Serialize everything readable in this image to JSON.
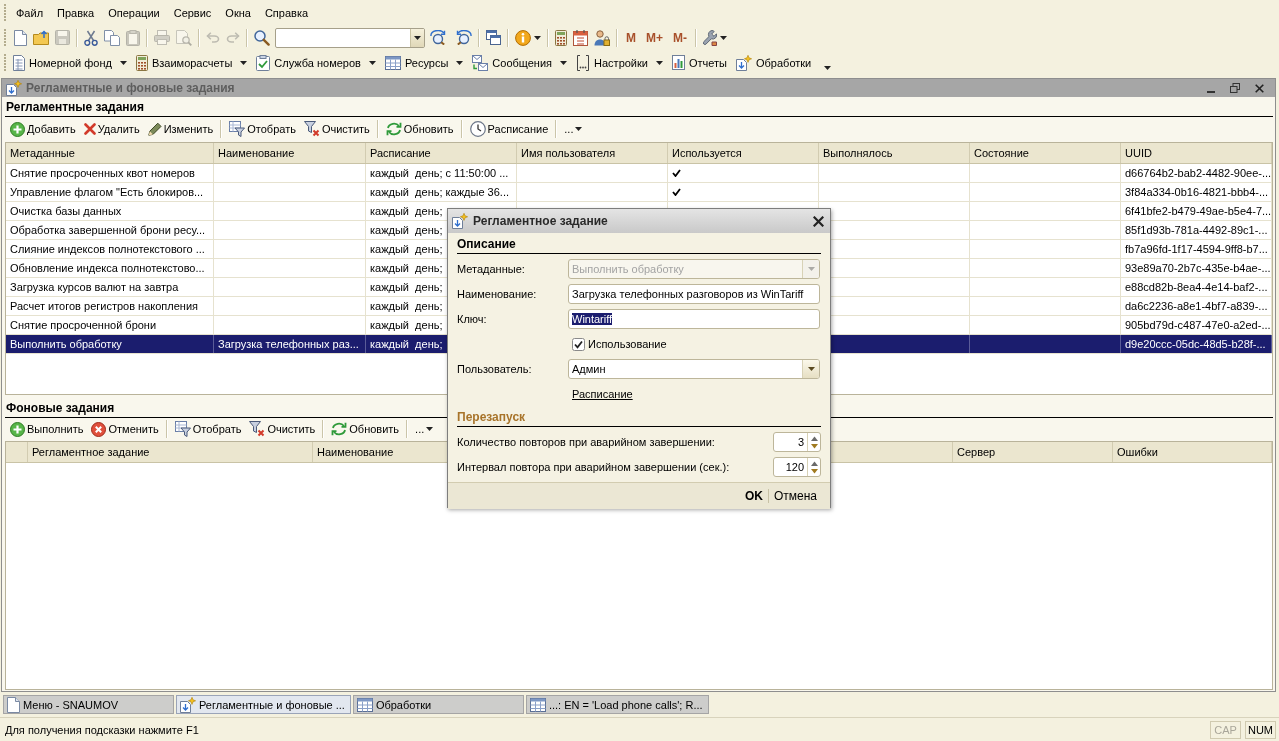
{
  "menu_bar": {
    "items": [
      {
        "label": "Файл"
      },
      {
        "label": "Правка"
      },
      {
        "label": "Операции"
      },
      {
        "label": "Сервис"
      },
      {
        "label": "Окна"
      },
      {
        "label": "Справка"
      }
    ]
  },
  "standard_toolbar": {
    "items": [
      {
        "kind": "button",
        "disabled": false,
        "dropdown": false
      },
      {
        "kind": "button",
        "disabled": false,
        "dropdown": false
      },
      {
        "kind": "button",
        "disabled": true,
        "dropdown": false
      },
      {
        "kind": "separator"
      },
      {
        "kind": "button",
        "disabled": false,
        "dropdown": false
      },
      {
        "kind": "button",
        "disabled": false,
        "dropdown": false
      },
      {
        "kind": "button",
        "disabled": true,
        "dropdown": false
      },
      {
        "kind": "separator"
      },
      {
        "kind": "button",
        "disabled": true,
        "dropdown": false
      },
      {
        "kind": "button",
        "disabled": true,
        "dropdown": false
      },
      {
        "kind": "separator"
      },
      {
        "kind": "button",
        "disabled": true,
        "dropdown": false
      },
      {
        "kind": "button",
        "disabled": true,
        "dropdown": false
      },
      {
        "kind": "separator"
      },
      {
        "kind": "button",
        "disabled": false,
        "dropdown": false
      },
      {
        "kind": "search"
      },
      {
        "kind": "button",
        "disabled": false,
        "dropdown": false
      },
      {
        "kind": "button",
        "disabled": false,
        "dropdown": false
      },
      {
        "kind": "separator"
      },
      {
        "kind": "button",
        "disabled": false,
        "dropdown": false
      },
      {
        "kind": "separator"
      },
      {
        "kind": "button",
        "disabled": false,
        "dropdown": true
      },
      {
        "kind": "separator"
      },
      {
        "kind": "button",
        "disabled": false,
        "dropdown": false
      },
      {
        "kind": "button",
        "disabled": false,
        "dropdown": false
      },
      {
        "kind": "button",
        "disabled": false,
        "dropdown": false
      },
      {
        "kind": "separator"
      },
      {
        "kind": "text",
        "label": "M"
      },
      {
        "kind": "text",
        "label": "M+"
      },
      {
        "kind": "text",
        "label": "M-"
      },
      {
        "kind": "separator"
      },
      {
        "kind": "button",
        "disabled": false,
        "dropdown": true
      }
    ]
  },
  "sections_toolbar": {
    "items": [
      {
        "label": "Номерной фонд",
        "dropdown": true
      },
      {
        "label": "Взаиморасчеты",
        "dropdown": true
      },
      {
        "label": "Служба номеров",
        "dropdown": true
      },
      {
        "label": "Ресурсы",
        "dropdown": true
      },
      {
        "label": "Сообщения",
        "dropdown": true
      },
      {
        "label": "Настройки",
        "dropdown": true
      },
      {
        "label": "Отчеты",
        "dropdown": false
      },
      {
        "label": "Обработки",
        "dropdown": false
      }
    ],
    "overflow": true
  },
  "window": {
    "title": "Регламентные и фоновые задания"
  },
  "scheduled_jobs": {
    "title": "Регламентные задания",
    "toolbar": [
      {
        "kind": "button",
        "label": "Добавить"
      },
      {
        "kind": "button",
        "label": "Удалить"
      },
      {
        "kind": "button",
        "label": "Изменить"
      },
      {
        "kind": "separator"
      },
      {
        "kind": "button",
        "label": "Отобрать"
      },
      {
        "kind": "button",
        "label": "Очистить"
      },
      {
        "kind": "separator"
      },
      {
        "kind": "button",
        "label": "Обновить"
      },
      {
        "kind": "separator"
      },
      {
        "kind": "button",
        "label": "Расписание"
      },
      {
        "kind": "separator"
      },
      {
        "kind": "menu",
        "label": "..."
      }
    ],
    "columns": [
      {
        "label": "Метаданные"
      },
      {
        "label": "Наименование"
      },
      {
        "label": "Расписание"
      },
      {
        "label": "Имя пользователя"
      },
      {
        "label": "Используется"
      },
      {
        "label": "Выполнялось"
      },
      {
        "label": "Состояние"
      },
      {
        "label": "UUID"
      }
    ],
    "rows": [
      {
        "metadata": "Снятие просроченных квот номеров",
        "schedule": "каждый  день; с 11:50:00 ...",
        "used": true,
        "uuid": "d66764b2-bab2-4482-90ee-...",
        "selected": false
      },
      {
        "metadata": "Управление флагом \"Есть блокиров...",
        "schedule": "каждый  день; каждые 36...",
        "used": true,
        "uuid": "3f84a334-0b16-4821-bbb4-...",
        "selected": false
      },
      {
        "metadata": "Очистка базы данных",
        "schedule": "каждый  день;",
        "uuid": "6f41bfe2-b479-49ae-b5e4-7...",
        "selected": false
      },
      {
        "metadata": "Обработка завершенной брони ресу...",
        "schedule": "каждый  день;",
        "uuid": "85f1d93b-781a-4492-89c1-...",
        "selected": false
      },
      {
        "metadata": "Слияние индексов полнотекстового ...",
        "schedule": "каждый  день;",
        "uuid": "fb7a96fd-1f17-4594-9ff8-b7...",
        "selected": false
      },
      {
        "metadata": "Обновление индекса полнотекстово...",
        "schedule": "каждый  день;",
        "uuid": "93e89a70-2b7c-435e-b4ae-...",
        "selected": false
      },
      {
        "metadata": "Загрузка курсов валют на завтра",
        "schedule": "каждый  день;",
        "uuid": "e88cd82b-8ea4-4e14-baf2-...",
        "selected": false
      },
      {
        "metadata": "Расчет итогов регистров накопления",
        "schedule": "каждый  день;",
        "uuid": "da6c2236-a8e1-4bf7-a839-...",
        "selected": false
      },
      {
        "metadata": "Снятие просроченной брони",
        "schedule": "каждый  день;",
        "uuid": "905bd79d-c487-47e0-a2ed-...",
        "selected": false
      },
      {
        "metadata": "Выполнить обработку",
        "name": "Загрузка телефонных раз...",
        "schedule": "каждый  день;",
        "uuid": "d9e20ccc-05dc-48d5-b28f-...",
        "selected": true
      }
    ]
  },
  "background_jobs": {
    "title": "Фоновые задания",
    "toolbar": [
      {
        "kind": "button",
        "label": "Выполнить"
      },
      {
        "kind": "button",
        "label": "Отменить"
      },
      {
        "kind": "separator"
      },
      {
        "kind": "button",
        "label": "Отобрать"
      },
      {
        "kind": "button",
        "label": "Очистить"
      },
      {
        "kind": "separator"
      },
      {
        "kind": "button",
        "label": "Обновить"
      },
      {
        "kind": "separator"
      },
      {
        "kind": "menu",
        "label": "..."
      }
    ],
    "columns": [
      {
        "label": "Регламентное задание"
      },
      {
        "label": "Наименование"
      },
      {
        "label": "Сервер"
      },
      {
        "label": "Ошибки"
      }
    ]
  },
  "dialog": {
    "title": "Регламентное задание",
    "description_section": "Описание",
    "fields": [
      {
        "kind": "combo",
        "label": "Метаданные:",
        "value": "Выполнить обработку",
        "disabled": true
      },
      {
        "kind": "text",
        "label": "Наименование:",
        "value": "Загрузка телефонных разговоров из WinTariff",
        "disabled": false,
        "text_selected": false
      },
      {
        "kind": "text",
        "label": "Ключ:",
        "value": "Wintariff",
        "disabled": false,
        "text_selected": true
      },
      {
        "kind": "checkbox",
        "label": "Использование",
        "checked": true
      },
      {
        "kind": "combo",
        "label": "Пользователь:",
        "value": "Админ",
        "disabled": false
      },
      {
        "kind": "link",
        "label": "Расписание"
      }
    ],
    "restart_section": "Перезапуск",
    "restart_fields": [
      {
        "label": "Количество повторов при аварийном завершении:",
        "value": "3"
      },
      {
        "label": "Интервал повтора при аварийном завершении (сек.):",
        "value": "120"
      }
    ],
    "buttons": [
      {
        "label": "OK",
        "default": true
      },
      {
        "label": "Отмена",
        "default": false
      }
    ]
  },
  "taskbar": [
    {
      "label": "Меню - SNAUMOV",
      "selected": false
    },
    {
      "label": "Регламентные и фоновые ...",
      "selected": true
    },
    {
      "label": "Обработки",
      "selected": false
    },
    {
      "label": "...: EN = 'Load phone calls'; R...",
      "selected": false
    }
  ],
  "status_bar": {
    "hint": "Для получения подсказки нажмите F1",
    "indicators": [
      {
        "label": "CAP",
        "on": false
      },
      {
        "label": "NUM",
        "on": true
      }
    ]
  }
}
